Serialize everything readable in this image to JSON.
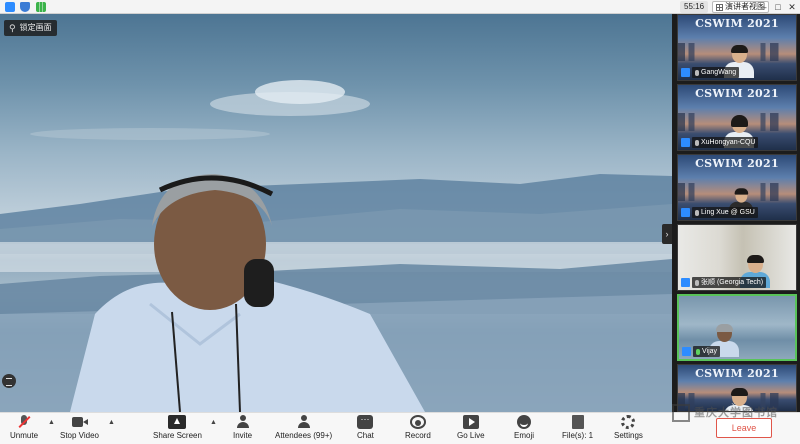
{
  "topbar": {
    "timer": "55:16",
    "view_mode_label": "演讲者视图",
    "win_minimize": "–",
    "win_maximize": "□",
    "win_close": "✕"
  },
  "main": {
    "pin_label": "锁定画面",
    "side_toggle": "›"
  },
  "gallery": {
    "banner": "CSWIM 2021",
    "participants": [
      {
        "name": "GangWang",
        "muted": true,
        "theme": "conference"
      },
      {
        "name": "XuHongyan-CQU",
        "muted": true,
        "theme": "conference"
      },
      {
        "name": "Ling Xue @ GSU",
        "muted": true,
        "theme": "conference"
      },
      {
        "name": "张顺 (Georgia Tech)",
        "muted": true,
        "theme": "room"
      },
      {
        "name": "Vijay",
        "muted": false,
        "theme": "plain",
        "active": true
      },
      {
        "name": "",
        "muted": true,
        "theme": "conference"
      }
    ],
    "chevron": "⌄"
  },
  "toolbar": {
    "unmute": "Unmute",
    "stop_video": "Stop Video",
    "share_screen": "Share Screen",
    "invite": "Invite",
    "attendees": "Attendees (99+)",
    "chat": "Chat",
    "record": "Record",
    "go_live": "Go Live",
    "emoji": "Emoji",
    "files": "File(s): 1",
    "settings": "Settings",
    "leave": "Leave"
  },
  "watermark": "重庆大学图书馆",
  "colors": {
    "accent_blue": "#2d8cff",
    "active_border": "#59c35a",
    "leave_red": "#e0564a"
  }
}
